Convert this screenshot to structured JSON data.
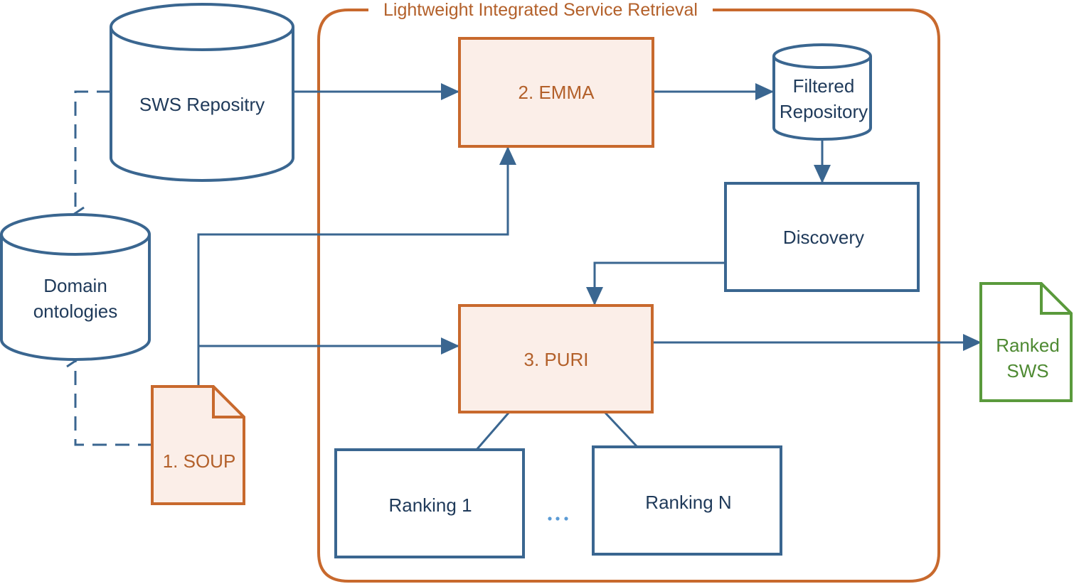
{
  "colors": {
    "blue": "#3a6690",
    "blue_text": "#1f3a5a",
    "orange": "#c8692d",
    "orange_fill": "#fbeee8",
    "green": "#5a9a3c",
    "dots": "#5b9bd5"
  },
  "container": {
    "title": "Lightweight Integrated Service Retrieval"
  },
  "nodes": {
    "sws_repository": {
      "label": "SWS Repositry",
      "shape": "cylinder"
    },
    "domain_ontologies": {
      "line1": "Domain",
      "line2": "ontologies",
      "shape": "cylinder"
    },
    "soup": {
      "label": "1. SOUP",
      "shape": "document"
    },
    "emma": {
      "label": "2. EMMA",
      "shape": "process"
    },
    "filtered_repository": {
      "line1": "Filtered",
      "line2": "Repository",
      "shape": "cylinder"
    },
    "discovery": {
      "label": "Discovery",
      "shape": "process"
    },
    "puri": {
      "label": "3. PURI",
      "shape": "process"
    },
    "ranking_1": {
      "label": "Ranking 1",
      "shape": "process"
    },
    "ranking_n": {
      "label": "Ranking N",
      "shape": "process"
    },
    "ellipsis": {
      "label": "..."
    },
    "ranked_sws": {
      "line1": "Ranked",
      "line2": "SWS",
      "shape": "document"
    }
  },
  "edges": [
    {
      "from": "sws_repository",
      "to": "emma",
      "style": "solid"
    },
    {
      "from": "emma",
      "to": "filtered_repository",
      "style": "solid"
    },
    {
      "from": "filtered_repository",
      "to": "discovery",
      "style": "solid"
    },
    {
      "from": "discovery",
      "to": "puri",
      "style": "solid"
    },
    {
      "from": "soup",
      "to": "emma",
      "style": "solid"
    },
    {
      "from": "soup",
      "to": "puri",
      "style": "solid"
    },
    {
      "from": "puri",
      "to": "ranked_sws",
      "style": "solid"
    },
    {
      "from": "puri",
      "to": "ranking_1",
      "style": "solid-line"
    },
    {
      "from": "puri",
      "to": "ranking_n",
      "style": "solid-line"
    },
    {
      "from": "sws_repository",
      "to": "domain_ontologies",
      "style": "dashed"
    },
    {
      "from": "soup",
      "to": "domain_ontologies",
      "style": "dashed"
    }
  ]
}
